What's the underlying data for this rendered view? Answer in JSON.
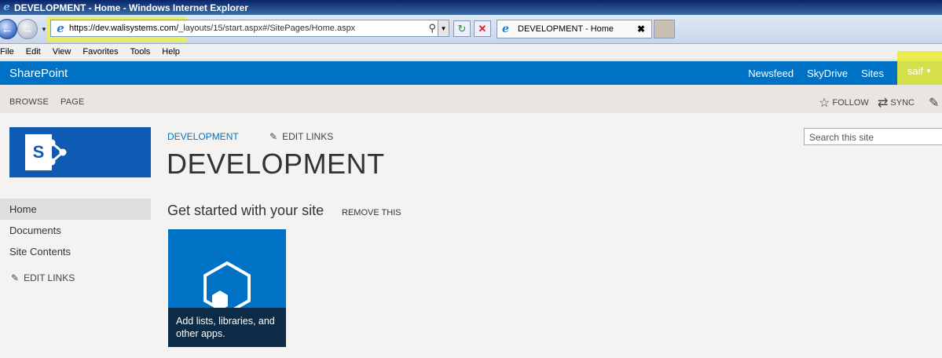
{
  "window": {
    "title": "DEVELOPMENT - Home - Windows Internet Explorer"
  },
  "browser": {
    "address_url_host": "https://dev.walisystems.com/",
    "address_url_path": "_layouts/15/start.aspx#/SitePages/Home.aspx",
    "tab_title": "DEVELOPMENT - Home",
    "tab_close": "✖"
  },
  "menu": {
    "items": [
      "File",
      "Edit",
      "View",
      "Favorites",
      "Tools",
      "Help"
    ]
  },
  "suite": {
    "brand": "SharePoint",
    "links": [
      "Newsfeed",
      "SkyDrive",
      "Sites"
    ],
    "user": "saif"
  },
  "ribbon": {
    "tabs": [
      "BROWSE",
      "PAGE"
    ],
    "follow": "FOLLOW",
    "sync": "SYNC"
  },
  "site": {
    "breadcrumb": "DEVELOPMENT",
    "edit_links_top": "EDIT LINKS",
    "title": "DEVELOPMENT",
    "search_placeholder": "Search this site"
  },
  "leftnav": {
    "items": [
      "Home",
      "Documents",
      "Site Contents"
    ],
    "edit_links": "EDIT LINKS"
  },
  "getstarted": {
    "heading": "Get started with your site",
    "remove": "REMOVE THIS",
    "tile_caption": "Add lists, libraries, and other apps."
  },
  "colors": {
    "suite_blue": "#0072c6",
    "highlight_yellow": "#ebeb3c",
    "tile_caption_bg": "#0b2b47"
  }
}
